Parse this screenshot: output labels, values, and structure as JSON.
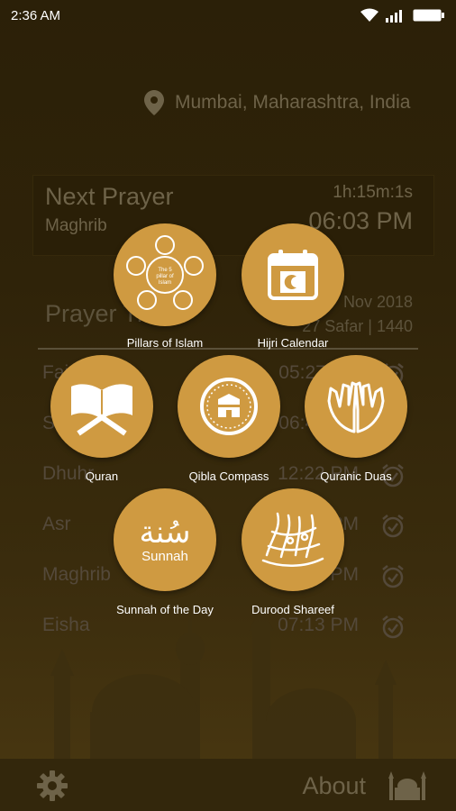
{
  "status_bar": {
    "time": "2:36 AM"
  },
  "location": "Mumbai, Maharashtra, India",
  "next_prayer": {
    "title": "Next Prayer",
    "name": "Maghrib",
    "remaining": "1h:15m:1s",
    "time": "06:03 PM"
  },
  "prayer_times": {
    "title": "Prayer Times",
    "date": "Nov 2018",
    "hijri": "27 Safar | 1440",
    "rows": [
      {
        "name": "Fajr",
        "time": "05:27 AM"
      },
      {
        "name": "Sunrise",
        "time": "06:46 AM"
      },
      {
        "name": "Dhuhr",
        "time": "12:22 PM"
      },
      {
        "name": "Asr",
        "time": "03:40 PM"
      },
      {
        "name": "Maghrib",
        "time": "06:03 PM"
      },
      {
        "name": "Eisha",
        "time": "07:13 PM"
      }
    ]
  },
  "menu": [
    {
      "id": "pillars",
      "label": "Pillars of Islam",
      "icon": "pillars-icon",
      "center_text": "The 5 pillar of Islam"
    },
    {
      "id": "hijri",
      "label": "Hijri Calendar",
      "icon": "calendar-icon"
    },
    {
      "id": "quran",
      "label": "Quran",
      "icon": "quran-book-icon"
    },
    {
      "id": "qibla",
      "label": "Qibla Compass",
      "icon": "kaaba-compass-icon"
    },
    {
      "id": "duas",
      "label": "Quranic Duas",
      "icon": "praying-hands-icon"
    },
    {
      "id": "sunnah",
      "label": "Sunnah of the Day",
      "icon": "sunnah-calligraphy-icon",
      "icon_text_ar": "سُنة",
      "icon_text_en": "Sunnah"
    },
    {
      "id": "durood",
      "label": "Durood Shareef",
      "icon": "durood-calligraphy-icon"
    }
  ],
  "bottom_bar": {
    "about": "About"
  },
  "colors": {
    "accent": "#cf9a41",
    "background": "#2f2309"
  }
}
